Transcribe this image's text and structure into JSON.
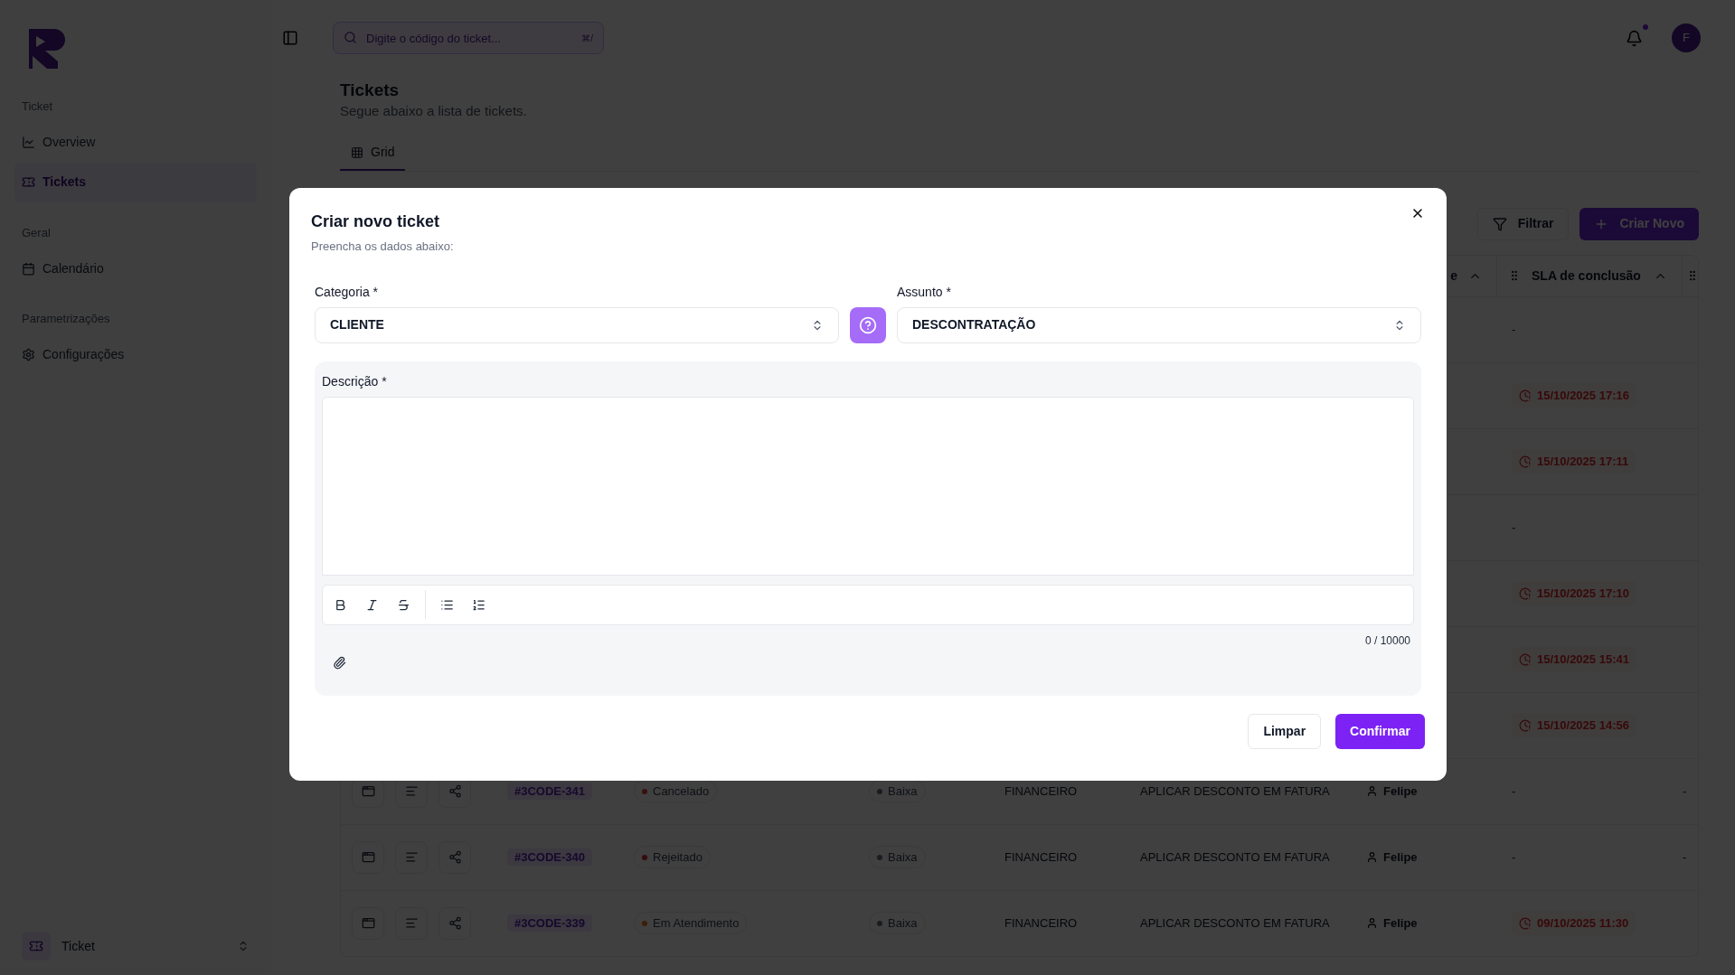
{
  "sidebar": {
    "sections": [
      {
        "title": "Ticket",
        "items": [
          {
            "label": "Overview",
            "selected": false
          },
          {
            "label": "Tickets",
            "selected": true
          }
        ]
      },
      {
        "title": "Geral",
        "items": [
          {
            "label": "Calendário",
            "selected": false
          }
        ]
      },
      {
        "title": "Parametrizações",
        "items": [
          {
            "label": "Configurações",
            "selected": false
          }
        ]
      }
    ],
    "footer": {
      "label": "Ticket"
    }
  },
  "header": {
    "search": {
      "placeholder": "Digite o código do ticket...",
      "shortcut": "⌘/"
    },
    "notifications_unread": true,
    "avatar": "F"
  },
  "page": {
    "title": "Tickets",
    "subtitle": "Segue abaixo a lista de tickets.",
    "tabs": [
      {
        "label": "Grid",
        "selected": true
      }
    ]
  },
  "toolbar": {
    "buttons": [
      {
        "label": "Filtrar",
        "kind": "outline"
      },
      {
        "label": "Criar Novo",
        "kind": "primary"
      }
    ]
  },
  "table": {
    "columns": [
      {
        "label": "e"
      },
      {
        "label": "SLA de conclusão"
      }
    ],
    "rows": [
      {
        "sla": "-"
      },
      {
        "sla": "15/10/2025 17:16"
      },
      {
        "sla": "15/10/2025 17:11"
      },
      {
        "sla": "-"
      },
      {
        "sla": "15/10/2025 17:10"
      },
      {
        "sla": "15/10/2025 15:41"
      },
      {
        "sla": "15/10/2025 14:56"
      },
      {
        "code": "#3CODE-341",
        "status": "Cancelado",
        "color": "#38110b",
        "priority": "Baixa",
        "category": "FINANCEIRO",
        "subject": "APLICAR DESCONTO EM FATURA",
        "assignee": "Felipe",
        "sla": "-",
        "column_10": "-"
      },
      {
        "code": "#3CODE-340",
        "status": "Rejeitado",
        "color": "#370a0a",
        "priority": "Baixa",
        "category": "FINANCEIRO",
        "subject": "APLICAR DESCONTO EM FATURA",
        "assignee": "Felipe",
        "sla": "-",
        "column_10": "-"
      },
      {
        "code": "#3CODE-339",
        "status": "Em Atendimento",
        "color": "#3e1d06",
        "priority": "Baixa",
        "category": "FINANCEIRO",
        "subject": "APLICAR DESCONTO EM FATURA",
        "assignee": "Felipe",
        "sla": "09/10/2025 11:30"
      }
    ]
  },
  "dialog": {
    "title": "Criar novo ticket",
    "subtitle": "Preencha os dados abaixo:",
    "fields": [
      {
        "label": "Categoria *",
        "value": "CLIENTE"
      },
      {
        "label": "Assunto *",
        "value": "DESCONTRATAÇÃO"
      }
    ],
    "description": {
      "label": "Descrição *",
      "counter": "0 / 10000"
    },
    "buttons": [
      {
        "label": "Limpar",
        "kind": "outline"
      },
      {
        "label": "Confirmar",
        "kind": "primary"
      }
    ]
  }
}
